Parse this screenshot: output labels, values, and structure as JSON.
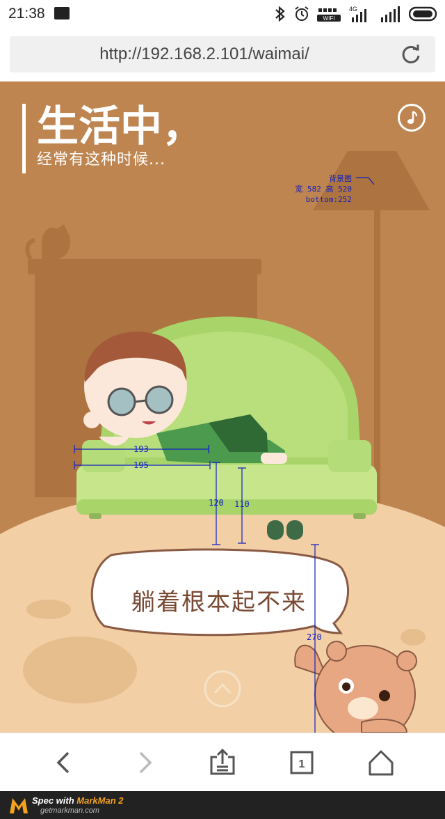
{
  "status_bar": {
    "time": "21:38",
    "network_label": "4G",
    "wifi_label": "WIFI"
  },
  "url_bar": {
    "url": "http://192.168.2.101/waimai/"
  },
  "page": {
    "headline": "生活中，",
    "subheadline": "经常有这种时候...",
    "bubble_text": "躺着根本起不来"
  },
  "annotations": {
    "bg_label": "背景图",
    "bg_size": "宽 582 高 520",
    "bg_bottom": "bottom:252",
    "dim_193": "193",
    "dim_195": "195",
    "dim_120": "120",
    "dim_110": "110",
    "dim_270": "270"
  },
  "footer": {
    "brand_prefix": "Spec with ",
    "brand_name": "MarkMan 2",
    "site": "getmarkman.com"
  },
  "colors": {
    "stage_bg": "#be8550",
    "floor": "#f2cfa4",
    "sofa": "#a8d46a",
    "annotation": "#1020c0"
  }
}
